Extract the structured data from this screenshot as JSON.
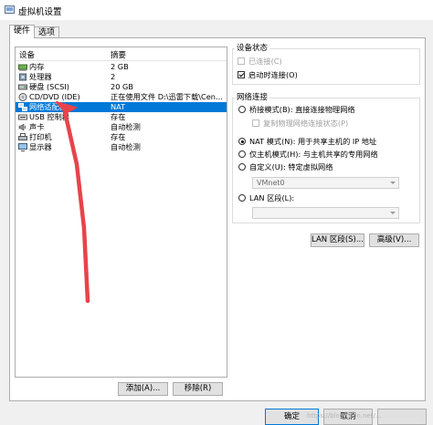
{
  "window": {
    "title": "虚拟机设置"
  },
  "tabs": [
    {
      "label": "硬件"
    },
    {
      "label": "选项"
    }
  ],
  "device_list": {
    "headers": {
      "device": "设备",
      "summary": "摘要"
    },
    "rows": [
      {
        "name": "内存",
        "summary": "2 GB",
        "icon": "memory-icon"
      },
      {
        "name": "处理器",
        "summary": "2",
        "icon": "processor-icon"
      },
      {
        "name": "硬盘 (SCSI)",
        "summary": "20 GB",
        "icon": "hard-disk-icon"
      },
      {
        "name": "CD/DVD (IDE)",
        "summary": "正在使用文件 D:\\迅雷下载\\Cen...",
        "icon": "cd-dvd-icon"
      },
      {
        "name": "网络适配器",
        "summary": "NAT",
        "icon": "network-adapter-icon",
        "selected": true
      },
      {
        "name": "USB 控制器",
        "summary": "存在",
        "icon": "usb-icon"
      },
      {
        "name": "声卡",
        "summary": "自动检测",
        "icon": "sound-card-icon"
      },
      {
        "name": "打印机",
        "summary": "存在",
        "icon": "printer-icon"
      },
      {
        "name": "显示器",
        "summary": "自动检测",
        "icon": "display-icon"
      }
    ],
    "add_button": "添加(A)...",
    "remove_button": "移除(R)"
  },
  "device_status": {
    "title": "设备状态",
    "connected": {
      "label": "已连接(C)",
      "checked": false,
      "disabled": true
    },
    "connect_at_power_on": {
      "label": "启动时连接(O)",
      "checked": true
    }
  },
  "network_connection": {
    "title": "网络连接",
    "bridged": {
      "label": "桥接模式(B): 直接连接物理网络",
      "selected": false
    },
    "replicate_state": {
      "label": "复制物理网络连接状态(P)",
      "checked": false,
      "disabled": true
    },
    "nat": {
      "label": "NAT 模式(N): 用于共享主机的 IP 地址",
      "selected": true
    },
    "host_only": {
      "label": "仅主机模式(H): 与主机共享的专用网络",
      "selected": false
    },
    "custom": {
      "label": "自定义(U): 特定虚拟网络",
      "selected": false,
      "value": "VMnet0"
    },
    "lan_segment": {
      "label": "LAN 区段(L):",
      "selected": false,
      "value": ""
    }
  },
  "buttons": {
    "lan_segments": "LAN 区段(S)...",
    "advanced": "高级(V)..."
  },
  "footer": {
    "ok": "确定",
    "cancel": "取消",
    "watermark": "https://blog.csdn.net/..."
  },
  "colors": {
    "selection": "#0078d7",
    "annotation_arrow": "#e8434a"
  }
}
